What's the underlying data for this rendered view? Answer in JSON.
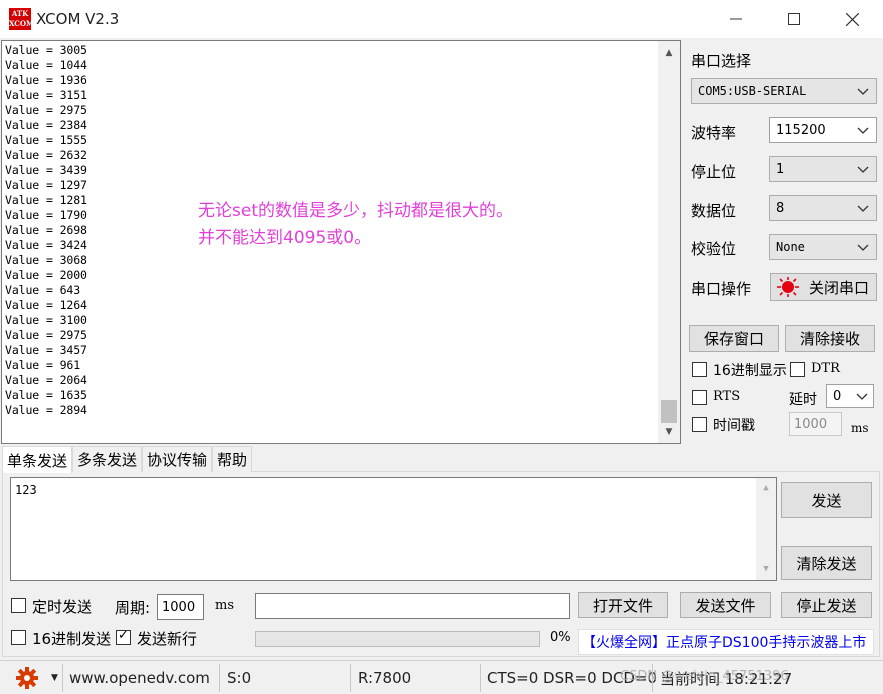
{
  "window": {
    "logo_top": "ATK",
    "logo_bottom": "XCOM",
    "title": "XCOM V2.3"
  },
  "receive": {
    "lines": [
      "Value = 3005",
      "Value = 1044",
      "Value = 1936",
      "Value = 3151",
      "Value = 2975",
      "Value = 2384",
      "Value = 1555",
      "Value = 2632",
      "Value = 3439",
      "Value = 1297",
      "Value = 1281",
      "Value = 1790",
      "Value = 2698",
      "Value = 3424",
      "Value = 3068",
      "Value = 2000",
      "Value = 643",
      "Value = 1264",
      "Value = 3100",
      "Value = 2975",
      "Value = 3457",
      "Value = 961",
      "Value = 2064",
      "Value = 1635",
      "Value = 2894"
    ],
    "annotation_line1": "无论set的数值是多少，抖动都是很大的。",
    "annotation_line2": "并不能达到4095或0。",
    "annotation_color": "#e040d8"
  },
  "settings": {
    "port_label": "串口选择",
    "port_value": "COM5:USB-SERIAL",
    "baud_label": "波特率",
    "baud_value": "115200",
    "stop_label": "停止位",
    "stop_value": "1",
    "data_label": "数据位",
    "data_value": "8",
    "parity_label": "校验位",
    "parity_value": "None",
    "op_label": "串口操作",
    "op_button": "关闭串口",
    "save_window": "保存窗口",
    "clear_recv": "清除接收",
    "hex_display": "16进制显示",
    "dtr": "DTR",
    "rts": "RTS",
    "delay_label": "延时",
    "delay_value": "0",
    "timestamp": "时间戳",
    "timestamp_value": "1000",
    "ms": "ms"
  },
  "tabs": [
    "单条发送",
    "多条发送",
    "协议传输",
    "帮助"
  ],
  "send": {
    "text": "123",
    "send_button": "发送",
    "clear_send": "清除发送",
    "timed_send": "定时发送",
    "period_label": "周期:",
    "period_value": "1000",
    "period_unit": "ms",
    "open_file": "打开文件",
    "send_file": "发送文件",
    "stop_send": "停止发送",
    "hex_send": "16进制发送",
    "send_newline": "发送新行",
    "progress_text": "0%",
    "progress_fraction": 0,
    "promo": "【火爆全网】正点原子DS100手持示波器上市"
  },
  "status": {
    "url": "www.openedv.com",
    "sent": "S:0",
    "received": "R:7800",
    "lines": "CTS=0 DSR=0 DCD=0",
    "time": "当前时间 18:21:27",
    "watermark": "CSDN @weixin_45751396"
  },
  "colors": {
    "led_red": "#e60012",
    "gear_red": "#d83b01",
    "promo_blue": "#0000ee"
  }
}
